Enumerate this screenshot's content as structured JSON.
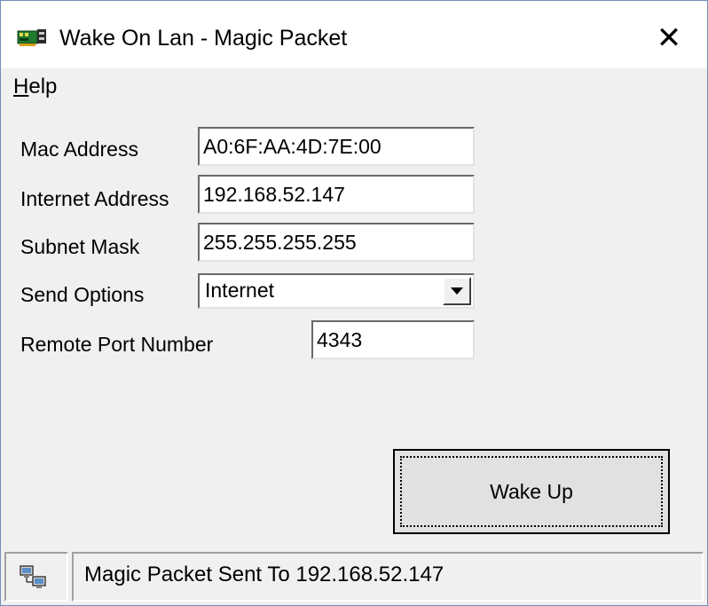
{
  "window": {
    "title": "Wake On Lan - Magic Packet",
    "close_label": "✕"
  },
  "menu": {
    "help_label_accel": "H",
    "help_label_rest": "elp"
  },
  "form": {
    "mac_label": "Mac Address",
    "mac_value": "A0:6F:AA:4D:7E:00",
    "ip_label": "Internet Address",
    "ip_value": "192.168.52.147",
    "subnet_label": "Subnet Mask",
    "subnet_value": "255.255.255.255",
    "send_label": "Send Options",
    "send_value": "Internet",
    "port_label": "Remote Port Number",
    "port_value": "4343"
  },
  "actions": {
    "wake_label": "Wake Up"
  },
  "status": {
    "text": "Magic Packet Sent To 192.168.52.147"
  },
  "colors": {
    "accent_window_border": "#6d8fb5",
    "face": "#f0f0f0"
  }
}
